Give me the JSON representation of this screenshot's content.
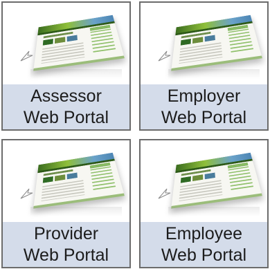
{
  "portals": [
    {
      "id": "assessor",
      "line1": "Assessor",
      "line2": "Web Portal"
    },
    {
      "id": "employer",
      "line1": "Employer",
      "line2": "Web Portal"
    },
    {
      "id": "provider",
      "line1": "Provider",
      "line2": "Web Portal"
    },
    {
      "id": "employee",
      "line1": "Employee",
      "line2": "Web Portal"
    }
  ],
  "colors": {
    "caption_bg": "#d4dcea",
    "tile_border": "#6b6b6b",
    "text": "#1c1c1c",
    "accent_green": "#8fbf3a"
  },
  "icons": {
    "thumbnail": "website-screenshot-icon",
    "pointer": "pointer-arrow-icon"
  }
}
